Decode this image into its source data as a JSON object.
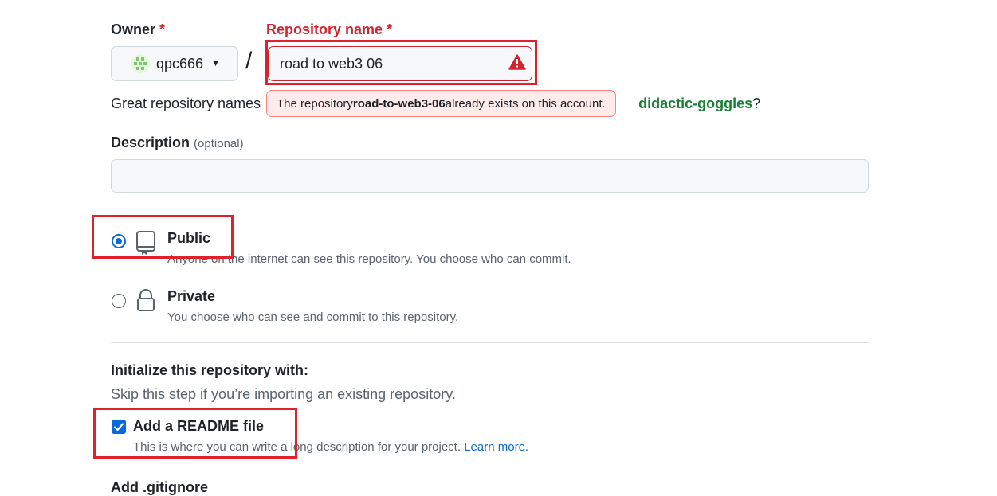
{
  "owner": {
    "label": "Owner",
    "required_mark": "*",
    "value": "qpc666"
  },
  "repo": {
    "label": "Repository name",
    "required_mark": "*",
    "value": "road to web3 06",
    "separator": "/"
  },
  "hint": {
    "prefix": "Great repository names",
    "suggestion": "didactic-goggles",
    "suffix": "?"
  },
  "error_tooltip": {
    "prefix": "The repository ",
    "repo_slug": "road-to-web3-06",
    "suffix": " already exists on this account."
  },
  "description": {
    "label": "Description",
    "optional": "(optional)",
    "value": ""
  },
  "visibility": {
    "options": [
      {
        "title": "Public",
        "desc": "Anyone on the internet can see this repository. You choose who can commit.",
        "selected": true,
        "icon": "repo-icon"
      },
      {
        "title": "Private",
        "desc": "You choose who can see and commit to this repository.",
        "selected": false,
        "icon": "lock-icon"
      }
    ]
  },
  "init": {
    "heading": "Initialize this repository with:",
    "subheading": "Skip this step if you’re importing an existing repository.",
    "readme_label": "Add a README file",
    "readme_checked": true,
    "readme_desc": "This is where you can write a long description for your project.",
    "readme_link": "Learn more."
  },
  "gitignore": {
    "label": "Add .gitignore"
  },
  "colors": {
    "accent": "#0969da",
    "danger": "#d1242f",
    "success": "#1a7f37",
    "highlight_box": "#e0202a"
  }
}
